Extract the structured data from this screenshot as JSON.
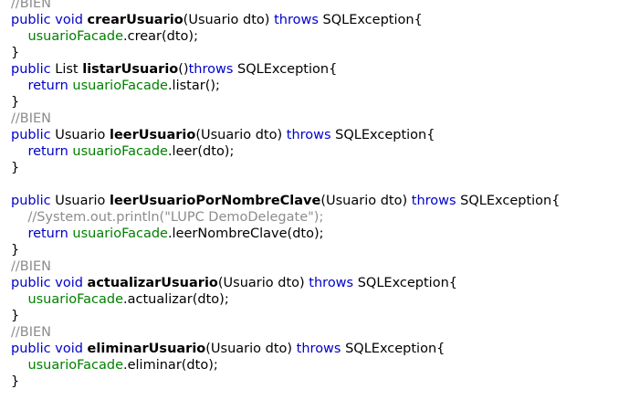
{
  "editor": {
    "lines": [
      {
        "tokens": [
          {
            "t": "//BIEN",
            "c": "comment"
          }
        ]
      },
      {
        "tokens": [
          {
            "t": "public",
            "c": "kw"
          },
          {
            "t": " ",
            "c": "plain"
          },
          {
            "t": "void",
            "c": "kw"
          },
          {
            "t": " ",
            "c": "plain"
          },
          {
            "t": "crearUsuario",
            "c": "fn"
          },
          {
            "t": "(Usuario dto) ",
            "c": "plain"
          },
          {
            "t": "throws",
            "c": "kw"
          },
          {
            "t": " SQLException{",
            "c": "plain"
          }
        ]
      },
      {
        "tokens": [
          {
            "t": "    ",
            "c": "plain"
          },
          {
            "t": "usuarioFacade",
            "c": "field"
          },
          {
            "t": ".crear(dto);",
            "c": "plain"
          }
        ]
      },
      {
        "tokens": [
          {
            "t": "}",
            "c": "plain"
          }
        ]
      },
      {
        "tokens": [
          {
            "t": "public",
            "c": "kw"
          },
          {
            "t": " List ",
            "c": "plain"
          },
          {
            "t": "listarUsuario",
            "c": "fn"
          },
          {
            "t": "()",
            "c": "plain"
          },
          {
            "t": "throws",
            "c": "kw"
          },
          {
            "t": " SQLException{",
            "c": "plain"
          }
        ]
      },
      {
        "tokens": [
          {
            "t": "    ",
            "c": "plain"
          },
          {
            "t": "return",
            "c": "kw"
          },
          {
            "t": " ",
            "c": "plain"
          },
          {
            "t": "usuarioFacade",
            "c": "field"
          },
          {
            "t": ".listar();",
            "c": "plain"
          }
        ]
      },
      {
        "tokens": [
          {
            "t": "}",
            "c": "plain"
          }
        ]
      },
      {
        "tokens": [
          {
            "t": "//BIEN",
            "c": "comment"
          }
        ]
      },
      {
        "tokens": [
          {
            "t": "public",
            "c": "kw"
          },
          {
            "t": " Usuario ",
            "c": "plain"
          },
          {
            "t": "leerUsuario",
            "c": "fn"
          },
          {
            "t": "(Usuario dto) ",
            "c": "plain"
          },
          {
            "t": "throws",
            "c": "kw"
          },
          {
            "t": " SQLException{",
            "c": "plain"
          }
        ]
      },
      {
        "tokens": [
          {
            "t": "    ",
            "c": "plain"
          },
          {
            "t": "return",
            "c": "kw"
          },
          {
            "t": " ",
            "c": "plain"
          },
          {
            "t": "usuarioFacade",
            "c": "field"
          },
          {
            "t": ".leer(dto);",
            "c": "plain"
          }
        ]
      },
      {
        "tokens": [
          {
            "t": "}",
            "c": "plain"
          }
        ]
      },
      {
        "tokens": []
      },
      {
        "tokens": [
          {
            "t": "public",
            "c": "kw"
          },
          {
            "t": " Usuario ",
            "c": "plain"
          },
          {
            "t": "leerUsuarioPorNombreClave",
            "c": "fn"
          },
          {
            "t": "(Usuario dto) ",
            "c": "plain"
          },
          {
            "t": "throws",
            "c": "kw"
          },
          {
            "t": " SQLException{",
            "c": "plain"
          }
        ]
      },
      {
        "tokens": [
          {
            "t": "    ",
            "c": "plain"
          },
          {
            "t": "//System.out.println(\"LUPC DemoDelegate\");",
            "c": "comment"
          }
        ]
      },
      {
        "tokens": [
          {
            "t": "    ",
            "c": "plain"
          },
          {
            "t": "return",
            "c": "kw"
          },
          {
            "t": " ",
            "c": "plain"
          },
          {
            "t": "usuarioFacade",
            "c": "field"
          },
          {
            "t": ".leerNombreClave(dto);",
            "c": "plain"
          }
        ]
      },
      {
        "tokens": [
          {
            "t": "}",
            "c": "plain"
          }
        ]
      },
      {
        "tokens": [
          {
            "t": "//BIEN",
            "c": "comment"
          }
        ]
      },
      {
        "tokens": [
          {
            "t": "public",
            "c": "kw"
          },
          {
            "t": " ",
            "c": "plain"
          },
          {
            "t": "void",
            "c": "kw"
          },
          {
            "t": " ",
            "c": "plain"
          },
          {
            "t": "actualizarUsuario",
            "c": "fn"
          },
          {
            "t": "(Usuario dto) ",
            "c": "plain"
          },
          {
            "t": "throws",
            "c": "kw"
          },
          {
            "t": " SQLException{",
            "c": "plain"
          }
        ]
      },
      {
        "tokens": [
          {
            "t": "    ",
            "c": "plain"
          },
          {
            "t": "usuarioFacade",
            "c": "field"
          },
          {
            "t": ".actualizar(dto);",
            "c": "plain"
          }
        ]
      },
      {
        "tokens": [
          {
            "t": "}",
            "c": "plain"
          }
        ]
      },
      {
        "tokens": [
          {
            "t": "//BIEN",
            "c": "comment"
          }
        ]
      },
      {
        "tokens": [
          {
            "t": "public",
            "c": "kw"
          },
          {
            "t": " ",
            "c": "plain"
          },
          {
            "t": "void",
            "c": "kw"
          },
          {
            "t": " ",
            "c": "plain"
          },
          {
            "t": "eliminarUsuario",
            "c": "fn"
          },
          {
            "t": "(Usuario dto) ",
            "c": "plain"
          },
          {
            "t": "throws",
            "c": "kw"
          },
          {
            "t": " SQLException{",
            "c": "plain"
          }
        ]
      },
      {
        "tokens": [
          {
            "t": "    ",
            "c": "plain"
          },
          {
            "t": "usuarioFacade",
            "c": "field"
          },
          {
            "t": ".eliminar(dto);",
            "c": "plain"
          }
        ]
      },
      {
        "tokens": [
          {
            "t": "}",
            "c": "plain"
          }
        ]
      }
    ],
    "colors": {
      "keyword": "#0000cc",
      "field": "#008000",
      "comment": "#8c8c8c",
      "text": "#000000",
      "background": "#ffffff"
    }
  }
}
